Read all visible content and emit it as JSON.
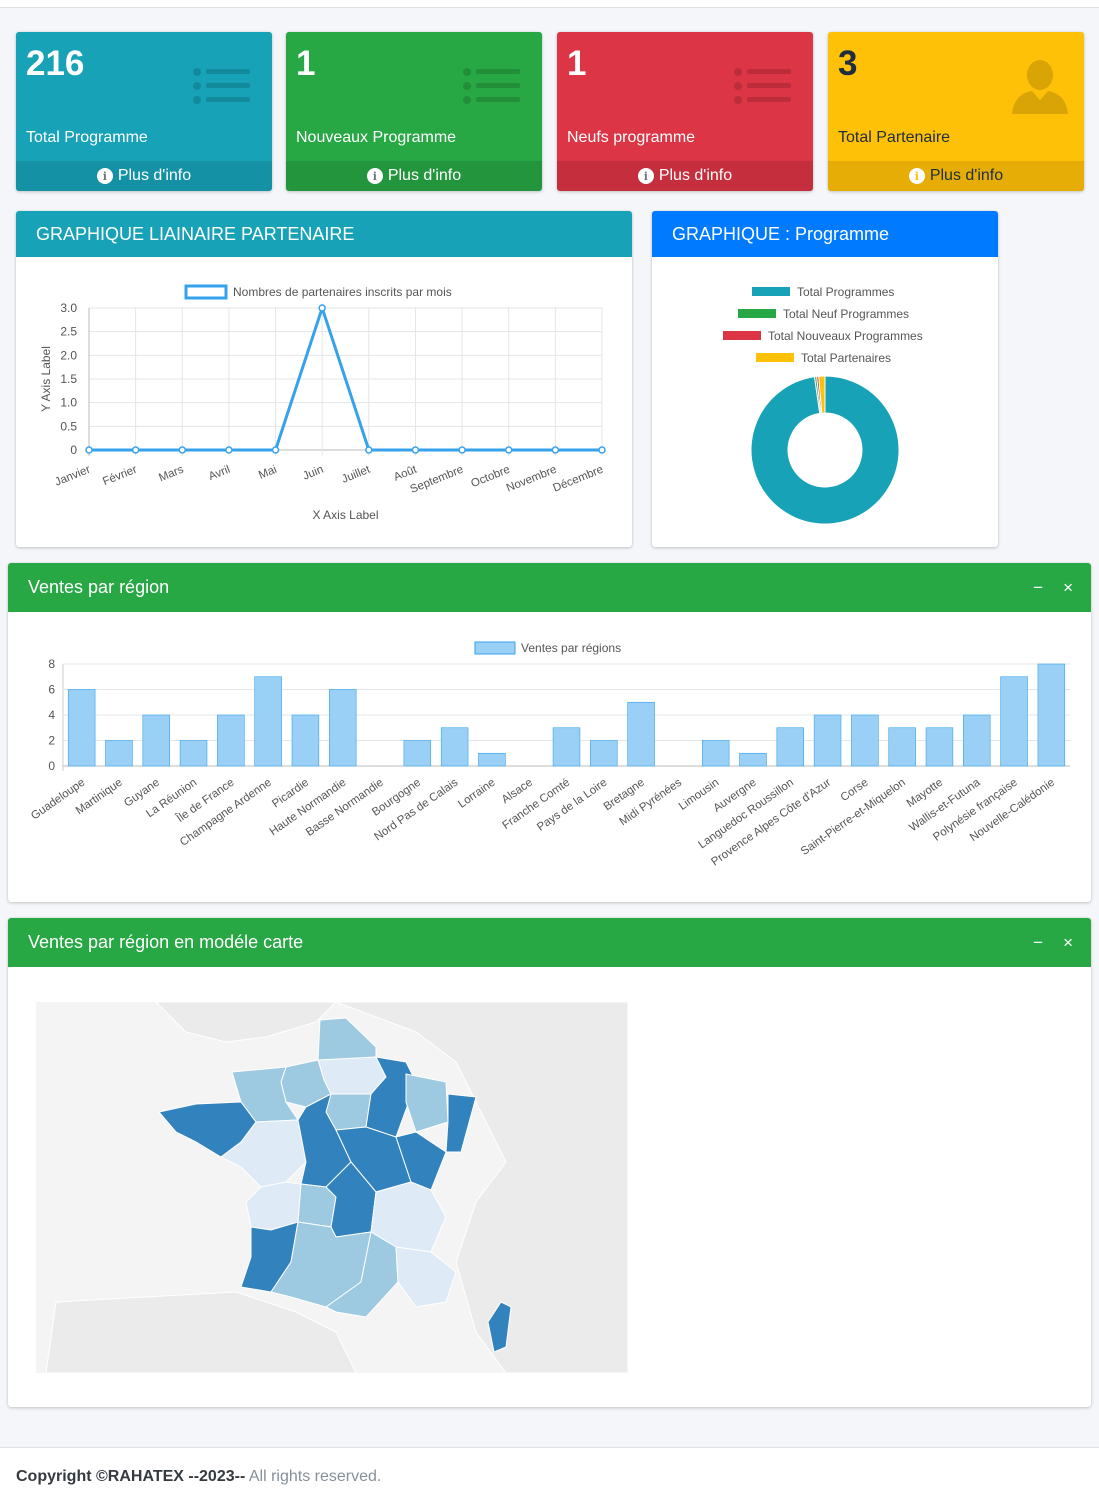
{
  "stats": [
    {
      "value": "216",
      "label": "Total Programme",
      "more": "Plus d'info",
      "icon": "list-icon"
    },
    {
      "value": "1",
      "label": "Nouveaux Programme",
      "more": "Plus d'info",
      "icon": "list-icon"
    },
    {
      "value": "1",
      "label": "Neufs programme",
      "more": "Plus d'info",
      "icon": "list-icon"
    },
    {
      "value": "3",
      "label": "Total Partenaire",
      "more": "Plus d'info",
      "icon": "user-icon"
    }
  ],
  "line_card": {
    "title": "GRAPHIQUE LIAINAIRE PARTENAIRE",
    "color": "#17a2b8"
  },
  "donut_card": {
    "title": "GRAPHIQUE : Programme",
    "color": "#007bff"
  },
  "bar_card": {
    "title": "Ventes par région",
    "color": "#28a745",
    "minimize": "−",
    "close": "×"
  },
  "map_card": {
    "title": "Ventes par région en modéle carte",
    "color": "#28a745",
    "minimize": "−",
    "close": "×"
  },
  "footer": {
    "copyright": "Copyright ©RAHATEX --2023--",
    "rights": "All rights reserved."
  },
  "chart_data": [
    {
      "type": "line",
      "legend": "Nombres de partenaires inscrits par mois",
      "xlabel": "X Axis Label",
      "ylabel": "Y Axis Label",
      "categories": [
        "Janvier",
        "Février",
        "Mars",
        "Avril",
        "Mai",
        "Juin",
        "Juillet",
        "Août",
        "Septembre",
        "Octobre",
        "Novembre",
        "Décembre"
      ],
      "values": [
        0,
        0,
        0,
        0,
        0,
        3,
        0,
        0,
        0,
        0,
        0,
        0
      ],
      "yticks": [
        "0",
        "0.5",
        "1.0",
        "1.5",
        "2.0",
        "2.5",
        "3.0"
      ],
      "ylim": [
        0,
        3
      ],
      "color": "#36a2eb",
      "grid": true,
      "legend_position": "top"
    },
    {
      "type": "pie",
      "donut": true,
      "labels": [
        "Total Programmes",
        "Total Neuf Programmes",
        "Total Nouveaux Programmes",
        "Total Partenaires"
      ],
      "values": [
        216,
        1,
        1,
        3
      ],
      "colors": [
        "#17a2b8",
        "#28a745",
        "#dc3545",
        "#ffc107"
      ],
      "legend_position": "top"
    },
    {
      "type": "bar",
      "legend": "Ventes par régions",
      "categories": [
        "Guadeloupe",
        "Martinique",
        "Guyane",
        "La Réunion",
        "Île de France",
        "Champagne Ardenne",
        "Picardie",
        "Haute Normandie",
        "Basse Normandie",
        "Bourgogne",
        "Nord Pas de Calais",
        "Lorraine",
        "Alsace",
        "Franche Comté",
        "Pays de la Loire",
        "Bretagne",
        "Midi Pyrénées",
        "Limousin",
        "Auvergne",
        "Languedoc Roussillon",
        "Provence Alpes Côte d'Azur",
        "Corse",
        "Saint-Pierre-et-Miquelon",
        "Mayotte",
        "Wallis-et-Futuna",
        "Polynésie française",
        "Nouvelle-Calédonie"
      ],
      "values": [
        6,
        2,
        4,
        2,
        4,
        7,
        4,
        6,
        0,
        2,
        3,
        1,
        0,
        3,
        2,
        5,
        0,
        2,
        1,
        3,
        4,
        4,
        3,
        3,
        4,
        7,
        8
      ],
      "yticks": [
        "0",
        "2",
        "4",
        "6",
        "8"
      ],
      "ylim": [
        0,
        8
      ],
      "color": "#9ad0f5",
      "border": "#36a2eb",
      "grid": true,
      "legend_position": "top"
    }
  ],
  "map_colors": {
    "dark": "#3182bd",
    "mid": "#9ecae1",
    "light": "#deebf7",
    "land": "#ebebeb",
    "sea": "#ffffff"
  }
}
